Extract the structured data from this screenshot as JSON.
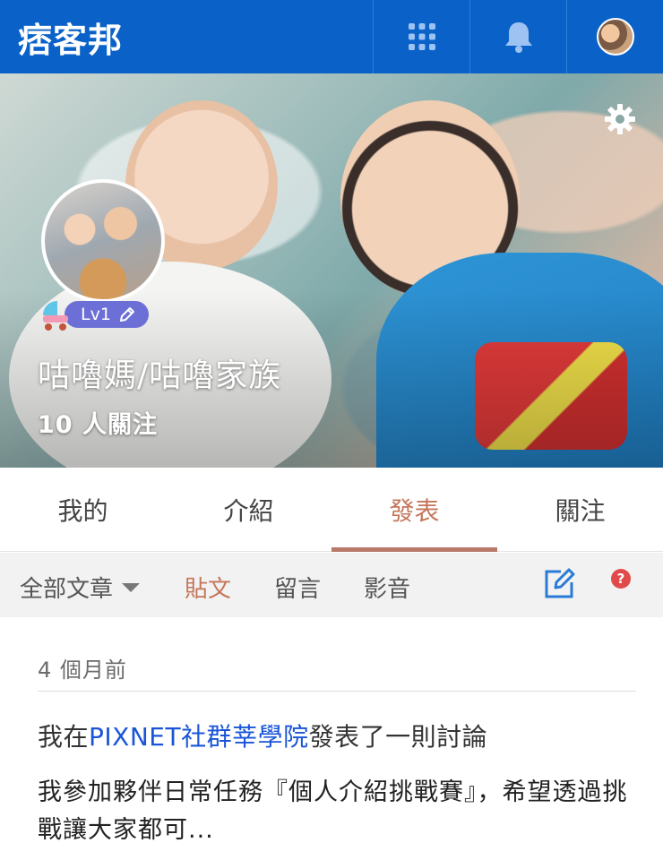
{
  "header": {
    "logo_text": "痞客邦",
    "icons": {
      "apps": "grid-apps-icon",
      "notifications": "bell-icon",
      "avatar": "user-avatar"
    }
  },
  "cover": {
    "settings_icon": "gear-icon",
    "level": "Lv1",
    "nickname": "咕嚕媽/咕嚕家族",
    "followers": "10 人關注"
  },
  "tabs": [
    {
      "label": "我的",
      "active": false
    },
    {
      "label": "介紹",
      "active": false
    },
    {
      "label": "發表",
      "active": true
    },
    {
      "label": "關注",
      "active": false
    }
  ],
  "subtabs": {
    "filter_label": "全部文章",
    "items": [
      {
        "label": "貼文",
        "active": true
      },
      {
        "label": "留言",
        "active": false
      },
      {
        "label": "影音",
        "active": false
      }
    ],
    "help_label": "?"
  },
  "feed": {
    "time": "4 個月前",
    "headline_prefix": "我在",
    "headline_link": "PIXNET社群莘學院",
    "headline_suffix": "發表了一則討論",
    "excerpt": "我參加夥伴日常任務『個人介紹挑戰賽』，希望透過挑戰讓大家都可..."
  },
  "colors": {
    "brand_blue": "#0a62c9",
    "active_tab": "#c4765a",
    "link": "#1a55d8",
    "level_badge": "#6b6fd6"
  }
}
